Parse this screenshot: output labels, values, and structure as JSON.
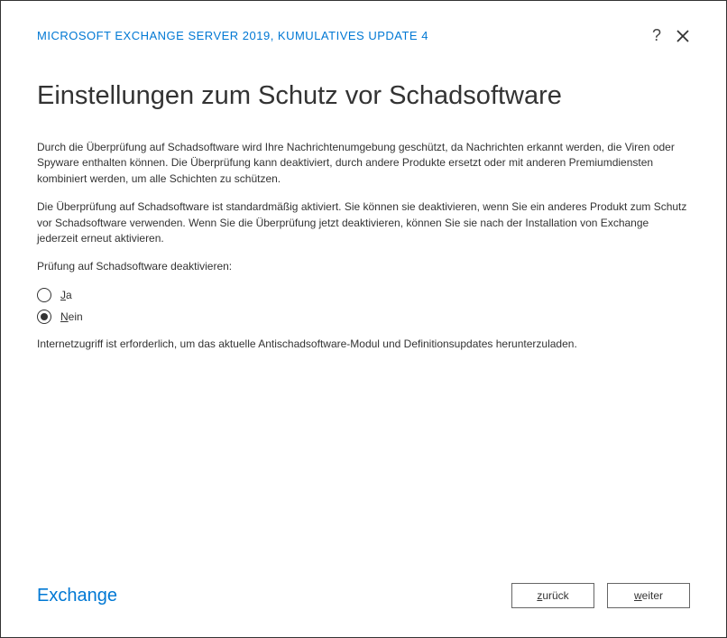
{
  "header": {
    "title": "MICROSOFT EXCHANGE SERVER 2019, KUMULATIVES UPDATE 4",
    "help_tooltip": "?",
    "close_tooltip": "✕"
  },
  "page": {
    "title": "Einstellungen zum Schutz vor Schadsoftware",
    "paragraph1": "Durch die Überprüfung auf Schadsoftware wird Ihre Nachrichtenumgebung geschützt, da Nachrichten erkannt werden, die Viren oder Spyware enthalten können. Die Überprüfung kann deaktiviert, durch andere Produkte ersetzt oder mit anderen Premiumdiensten kombiniert werden, um alle Schichten zu schützen.",
    "paragraph2": "Die Überprüfung auf Schadsoftware ist standardmäßig aktiviert. Sie können sie deaktivieren, wenn Sie ein anderes Produkt zum Schutz vor Schadsoftware verwenden. Wenn Sie die Überprüfung jetzt deaktivieren, können Sie sie nach der Installation von Exchange jederzeit erneut aktivieren.",
    "question": "Prüfung auf Schadsoftware deaktivieren:",
    "options": {
      "yes_accelerator": "J",
      "yes_rest": "a",
      "no_accelerator": "N",
      "no_rest": "ein",
      "selected": "no"
    },
    "note": "Internetzugriff ist erforderlich, um das aktuelle Antischadsoftware-Modul und Definitionsupdates herunterzuladen."
  },
  "footer": {
    "brand": "Exchange",
    "back_accelerator": "z",
    "back_rest": "urück",
    "next_accelerator": "w",
    "next_rest": "eiter"
  }
}
